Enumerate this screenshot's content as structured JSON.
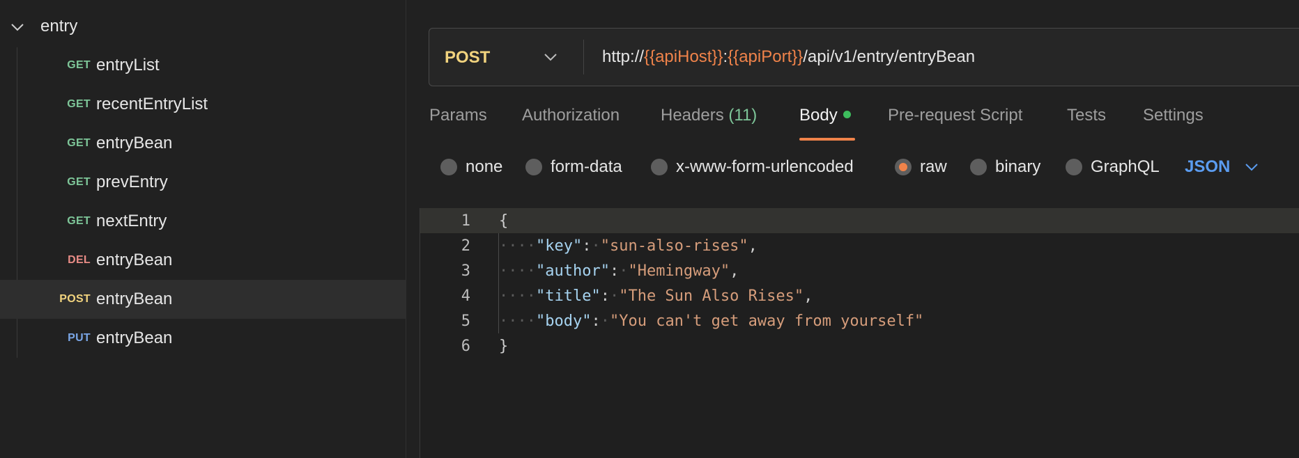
{
  "sidebar": {
    "folder": {
      "label": "entry"
    },
    "requests": [
      {
        "method": "GET",
        "name": "entryList"
      },
      {
        "method": "GET",
        "name": "recentEntryList"
      },
      {
        "method": "GET",
        "name": "entryBean"
      },
      {
        "method": "GET",
        "name": "prevEntry"
      },
      {
        "method": "GET",
        "name": "nextEntry"
      },
      {
        "method": "DEL",
        "name": "entryBean"
      },
      {
        "method": "POST",
        "name": "entryBean",
        "active": true
      },
      {
        "method": "PUT",
        "name": "entryBean"
      }
    ]
  },
  "request": {
    "method": "POST",
    "url": {
      "prefix": "http://",
      "var1": "{{apiHost}}",
      "sep": ":",
      "var2": "{{apiPort}}",
      "path": "/api/v1/entry/entryBean"
    }
  },
  "tabs": {
    "params": "Params",
    "authorization": "Authorization",
    "headers": "Headers",
    "headers_count": "(11)",
    "body": "Body",
    "prerequest": "Pre-request Script",
    "tests": "Tests",
    "settings": "Settings",
    "active": "Body"
  },
  "body_types": {
    "none": "none",
    "form_data": "form-data",
    "urlencoded": "x-www-form-urlencoded",
    "raw": "raw",
    "binary": "binary",
    "graphql": "GraphQL",
    "selected": "raw",
    "language": "JSON"
  },
  "editor": {
    "line_numbers": [
      "1",
      "2",
      "3",
      "4",
      "5",
      "6"
    ],
    "open_brace": "{",
    "close_brace": "}",
    "fields": [
      {
        "key": "\"key\"",
        "value": "\"sun-also-rises\"",
        "comma": ","
      },
      {
        "key": "\"author\"",
        "value": "\"Hemingway\"",
        "comma": ","
      },
      {
        "key": "\"title\"",
        "value": "\"The Sun Also Rises\"",
        "comma": ","
      },
      {
        "key": "\"body\"",
        "value": "\"You can't get away from yourself\"",
        "comma": ""
      }
    ]
  },
  "colors": {
    "get": "#7ec699",
    "del": "#e88c86",
    "post": "#f1d37e",
    "put": "#7aa6e6",
    "accent": "#f0834a",
    "json": "#5b9cf0",
    "status_dot": "#3dbd5d"
  }
}
